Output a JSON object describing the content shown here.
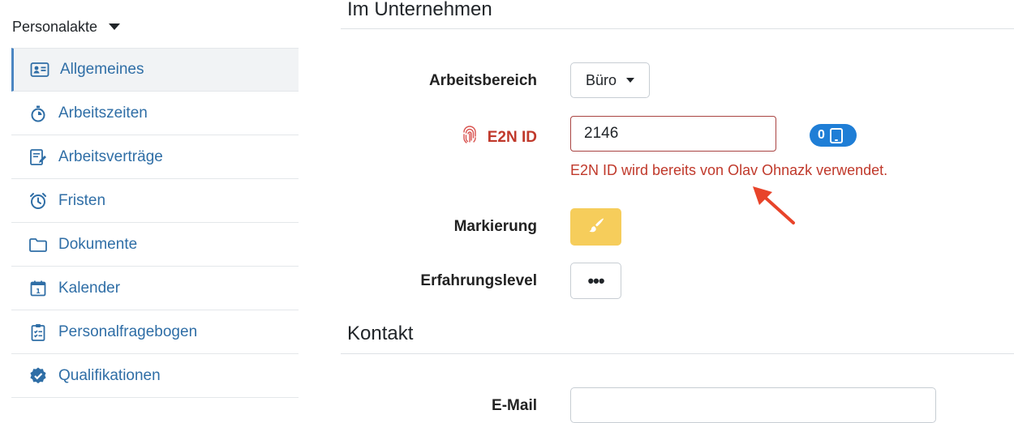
{
  "sidebar": {
    "section_label": "Personalakte",
    "items": [
      {
        "label": "Allgemeines",
        "icon": "id-card-icon",
        "active": true
      },
      {
        "label": "Arbeitszeiten",
        "icon": "stopwatch-icon"
      },
      {
        "label": "Arbeitsverträge",
        "icon": "contract-edit-icon"
      },
      {
        "label": "Fristen",
        "icon": "alarm-clock-icon"
      },
      {
        "label": "Dokumente",
        "icon": "folder-icon"
      },
      {
        "label": "Kalender",
        "icon": "calendar-icon"
      },
      {
        "label": "Personalfragebogen",
        "icon": "clipboard-checklist-icon"
      },
      {
        "label": "Qualifikationen",
        "icon": "verified-badge-icon"
      }
    ]
  },
  "main": {
    "section_company": "Im Unternehmen",
    "section_contact": "Kontakt",
    "fields": {
      "arbeitsbereich": {
        "label": "Arbeitsbereich",
        "value": "Büro"
      },
      "e2n_id": {
        "label": "E2N ID",
        "value": "2146",
        "error": "E2N ID wird bereits von Olav Ohnazk verwendet.",
        "device_count": "0"
      },
      "markierung": {
        "label": "Markierung"
      },
      "erfahrungslevel": {
        "label": "Erfahrungslevel",
        "button_text": "•••"
      },
      "email": {
        "label": "E-Mail",
        "value": ""
      }
    }
  },
  "colors": {
    "link": "#2f6ea6",
    "error": "#c0392b",
    "badge": "#1f7ed6",
    "marker": "#f6cd5b",
    "annotation_arrow": "#e8442a"
  }
}
